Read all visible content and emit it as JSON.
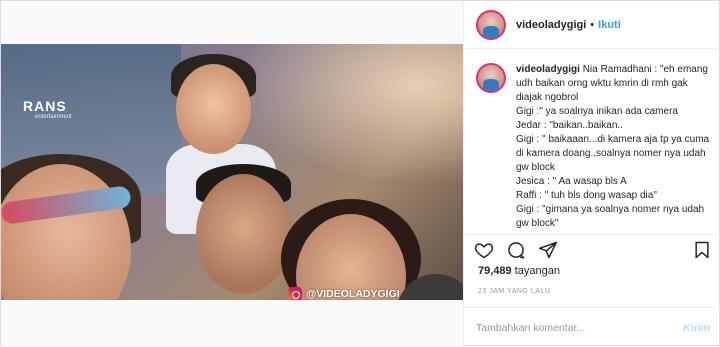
{
  "media": {
    "brand_logo": "RANS",
    "brand_sub": "entertainment",
    "watermark": "@VIDEOLADYGIGI"
  },
  "header": {
    "username": "videoladygigi",
    "separator": "•",
    "follow_label": "Ikuti"
  },
  "caption": {
    "username": "videoladygigi",
    "lines": [
      "Nia Ramadhani : \"eh emang udh baikan orng wktu kmrin di rmh gak diajak ngobrol",
      "Gigi :\" ya soalnya inikan ada camera",
      "Jedar : \"baikan..baikan..",
      "Gigi : \" baikaaan...di kamera aja tp ya cuma di kamera doang..soalnya nomer nya udah gw block",
      "Jesica : \" Aa wasap bls A",
      "Raffi : \" tuh bls dong wasap dia\"",
      "Gigi : \"gimana ya soalnya nomer nya udah gw block\""
    ]
  },
  "actions": {
    "like_icon": "heart-icon",
    "comment_icon": "comment-icon",
    "share_icon": "share-icon",
    "save_icon": "bookmark-icon"
  },
  "stats": {
    "views_count": "79,489",
    "views_label": "tayangan",
    "timestamp": "23 JAM YANG LALU"
  },
  "comment": {
    "placeholder": "Tambahkan komentar...",
    "send_label": "Kirim"
  },
  "colors": {
    "link": "#3897f0",
    "send_disabled": "#b2dffc",
    "text": "#262626",
    "muted": "#999999",
    "border": "#efefef"
  }
}
